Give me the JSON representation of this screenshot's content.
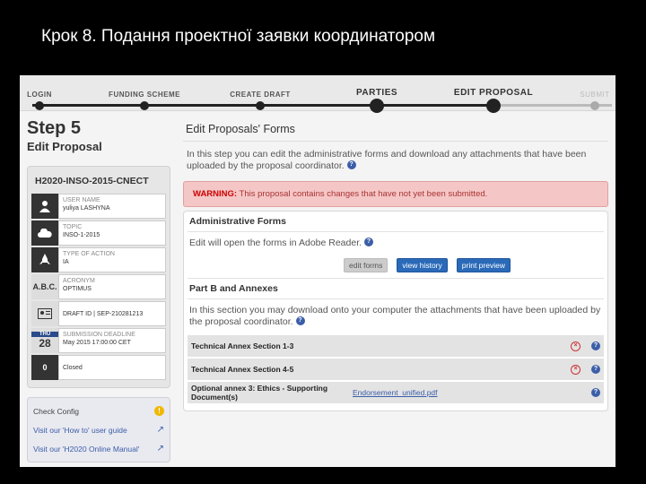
{
  "slide": {
    "title": "Крок 8. Подання проектної заявки координатором"
  },
  "wizard": {
    "steps": [
      {
        "label": "LOGIN"
      },
      {
        "label": "FUNDING SCHEME"
      },
      {
        "label": "CREATE DRAFT"
      },
      {
        "label": "PARTIES"
      },
      {
        "label": "EDIT PROPOSAL"
      },
      {
        "label": "SUBMIT"
      }
    ]
  },
  "sidebar": {
    "step_title": "Step 5",
    "step_subtitle": "Edit Proposal",
    "call_id": "H2020-INSO-2015-CNECT",
    "rows": [
      {
        "icon": "user-icon",
        "key": "USER NAME",
        "value": "yuliya LASHYNA"
      },
      {
        "icon": "cloud-icon",
        "key": "TOPIC",
        "value": "INSO-1-2015"
      },
      {
        "icon": "rocket-icon",
        "key": "TYPE OF ACTION",
        "value": "IA"
      },
      {
        "icon": "abc-icon",
        "key": "ACRONYM",
        "value": "OPTIMUS"
      },
      {
        "icon": "id-card-icon",
        "key": "",
        "value": "DRAFT ID | SEP-210281213"
      },
      {
        "icon": "calendar-icon",
        "key": "SUBMISSION DEADLINE",
        "value": "May 2015 17:00:00 CET"
      },
      {
        "icon": "status-icon",
        "key": "",
        "value": "Closed"
      }
    ],
    "abc_glyph": "A.B.C.",
    "cal_day": "THU",
    "cal_num": "28",
    "status_num": "0",
    "config": {
      "check_label": "Check Config",
      "howto_label": "Visit our 'How to' user guide",
      "manual_label": "Visit our 'H2020 Online Manual'"
    }
  },
  "main": {
    "title": "Edit Proposals' Forms",
    "intro": "In this step you can edit the administrative forms and download any attachments that have been uploaded by the proposal coordinator.",
    "warning_label": "WARNING:",
    "warning_text": " This proposal contains changes that have not yet been submitted.",
    "admin": {
      "heading": "Administrative Forms",
      "text": "Edit will open the forms in Adobe Reader.",
      "edit_label": "edit forms",
      "history_label": "view history",
      "print_label": "print preview"
    },
    "partb": {
      "heading": "Part B and Annexes",
      "text": "In this section you may download onto your computer the attachments that have been uploaded by the proposal coordinator.",
      "annexes": [
        {
          "name": "Technical Annex Section 1-3",
          "file": ""
        },
        {
          "name": "Technical Annex Section 4-5",
          "file": ""
        },
        {
          "name": "Optional annex 3: Ethics - Supporting Document(s)",
          "file": "Endorsement_unified.pdf"
        }
      ]
    },
    "help_glyph": "?",
    "delete_glyph": "×"
  },
  "colors": {
    "accent": "#2a6ab8",
    "warning_bg": "#f5c6c6",
    "warning_text": "#cc0000"
  }
}
